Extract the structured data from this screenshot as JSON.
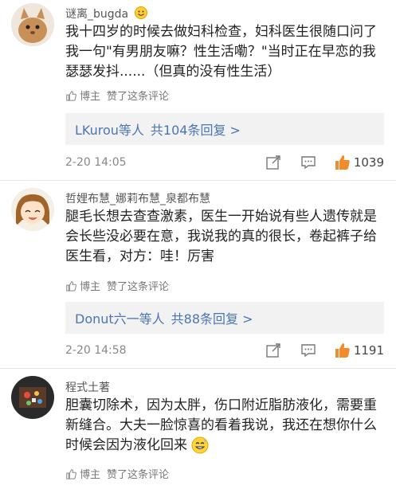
{
  "comments": [
    {
      "username": "谜离_bugda",
      "text": "我十四岁的时候去做妇科检查，妇科医生很随口问了我一句\"有男朋友嘛？性生活嘞？\"当时正在早恋的我瑟瑟发抖......（但真的没有性生活）",
      "liked_by": "博主",
      "liked_suffix": "赞了这条评论",
      "reply_users": "LKurou等人",
      "reply_count": "共104条回复 >",
      "time": "2-20 14:05",
      "likes": "1039"
    },
    {
      "username": "哲娌布慧_娜莉布慧_泉都布慧",
      "text": "腿毛长想去查查激素，医生一开始说有些人遗传就是会长些没必要在意，我说我的真的很长，卷起裤子给医生看，对方：哇！厉害",
      "liked_by": "博主",
      "liked_suffix": "赞了这条评论",
      "reply_users": "Donut六一等人",
      "reply_count": "共88条回复 >",
      "time": "2-20 14:58",
      "likes": "1191"
    },
    {
      "username": "程式土著",
      "text": "胆囊切除术，因为太胖，伤口附近脂肪液化，需要重新缝合。大夫一脸惊喜的看着我说，我还在想你什么时候会因为液化回来",
      "liked_by": "博主",
      "liked_suffix": "赞了这条评论"
    }
  ],
  "colors": {
    "accent_link": "#4a76b4",
    "like_orange": "#f28b2c"
  },
  "icons": {
    "badge": "emoji-badge-icon",
    "share": "share-icon",
    "comment": "comment-icon",
    "like": "thumbs-up-icon",
    "liked_small": "thumbs-up-outline-icon",
    "emoji_inline": "sweat-smile-emoji-icon"
  }
}
